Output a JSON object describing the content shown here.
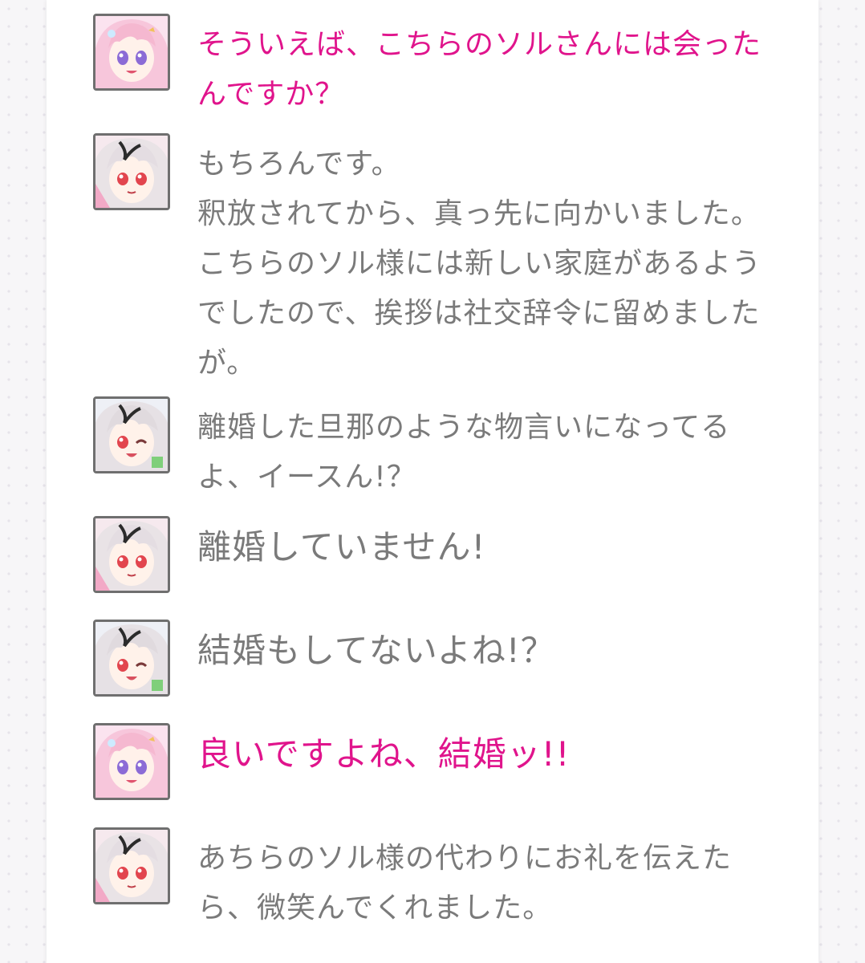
{
  "colors": {
    "pink_text": "#e0148c",
    "gray_text": "#7a7a7a",
    "background": "#f7f6f8"
  },
  "messages": [
    {
      "speaker_icon": "pink-haired-girl-avatar-icon",
      "text": "そういえば、こちらのソルさんには会ったんですか？"
    },
    {
      "speaker_icon": "white-haired-girl-avatar-icon",
      "text": "もちろんです。\n釈放されてから、真っ先に向かいました。\nこちらのソル様には新しい家庭があるようでしたので、挨拶は社交辞令に留めましたが。"
    },
    {
      "speaker_icon": "white-haired-girl-winking-avatar-icon",
      "text": "離婚した旦那のような物言いになってるよ、イースん!？"
    },
    {
      "speaker_icon": "white-haired-girl-avatar-icon",
      "text": "離婚していません!"
    },
    {
      "speaker_icon": "white-haired-girl-winking-avatar-icon",
      "text": "結婚もしてないよね!？"
    },
    {
      "speaker_icon": "pink-haired-girl-avatar-icon",
      "text": "良いですよね、結婚ッ!!"
    },
    {
      "speaker_icon": "white-haired-girl-avatar-icon",
      "text": "あちらのソル様の代わりにお礼を伝えたら、微笑んでくれました。"
    }
  ]
}
